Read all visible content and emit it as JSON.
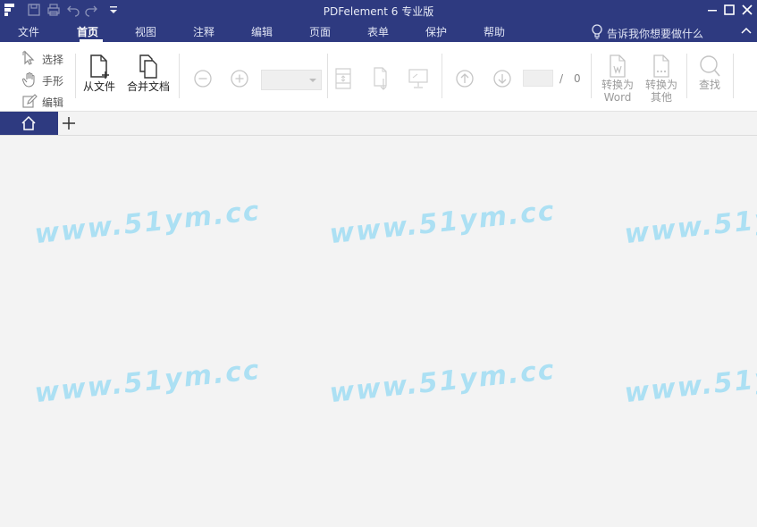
{
  "window": {
    "title": "PDFelement  6 专业版"
  },
  "menu": {
    "items": [
      {
        "label": "文件",
        "active": false
      },
      {
        "label": "首页",
        "active": true
      },
      {
        "label": "视图",
        "active": false
      },
      {
        "label": "注释",
        "active": false
      },
      {
        "label": "编辑",
        "active": false
      },
      {
        "label": "页面",
        "active": false
      },
      {
        "label": "表单",
        "active": false
      },
      {
        "label": "保护",
        "active": false
      },
      {
        "label": "帮助",
        "active": false
      }
    ],
    "tell_me": "告诉我你想要做什么"
  },
  "ribbon": {
    "select_label": "选择",
    "hand_label": "手形",
    "edit_label": "编辑",
    "from_file_label": "从文件",
    "combine_label": "合并文档",
    "page_total": "0",
    "page_slash": "/",
    "to_word_line1": "转换为",
    "to_word_line2": "Word",
    "to_other_line1": "转换为",
    "to_other_line2": "其他",
    "find_label": "查找"
  },
  "watermark": "www.51ym.cc",
  "colors": {
    "chrome": "#2e3a80",
    "watermark": "#a9e0f3"
  }
}
